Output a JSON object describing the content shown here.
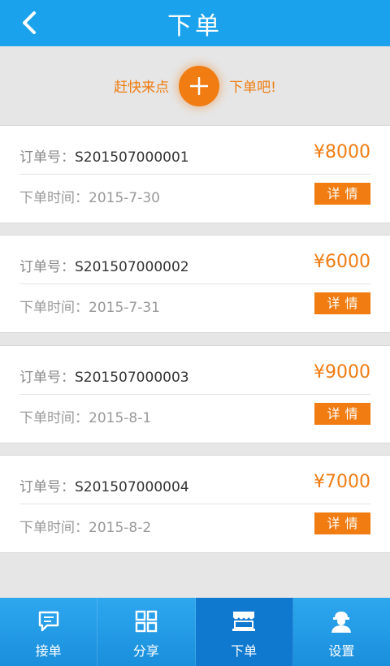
{
  "header": {
    "title": "下单",
    "back_icon": "chevron-left-icon"
  },
  "banner": {
    "left_text": "赶快来点",
    "right_text": "下单吧!",
    "plus_icon": "plus-icon"
  },
  "orders": [
    {
      "label": "订单号：",
      "number": "S201507000001",
      "price": "¥8000",
      "time": "下单时间：2015-7-30",
      "detail_label": "详情"
    },
    {
      "label": "订单号：",
      "number": "S201507000002",
      "price": "¥6000",
      "time": "下单时间：2015-7-31",
      "detail_label": "详情"
    },
    {
      "label": "订单号：",
      "number": "S201507000003",
      "price": "¥9000",
      "time": "下单时间：2015-8-1",
      "detail_label": "详情"
    },
    {
      "label": "订单号：",
      "number": "S201507000004",
      "price": "¥7000",
      "time": "下单时间：2015-8-2",
      "detail_label": "详情"
    }
  ],
  "tabbar": {
    "tabs": [
      {
        "label": "接单",
        "icon": "message-icon"
      },
      {
        "label": "分享",
        "icon": "grid-icon"
      },
      {
        "label": "下单",
        "icon": "shop-icon",
        "active": true
      },
      {
        "label": "设置",
        "icon": "user-helmet-icon"
      }
    ]
  },
  "colors": {
    "primary": "#1aa3ec",
    "accent": "#f07c12",
    "active_tab": "#0f78cf"
  }
}
